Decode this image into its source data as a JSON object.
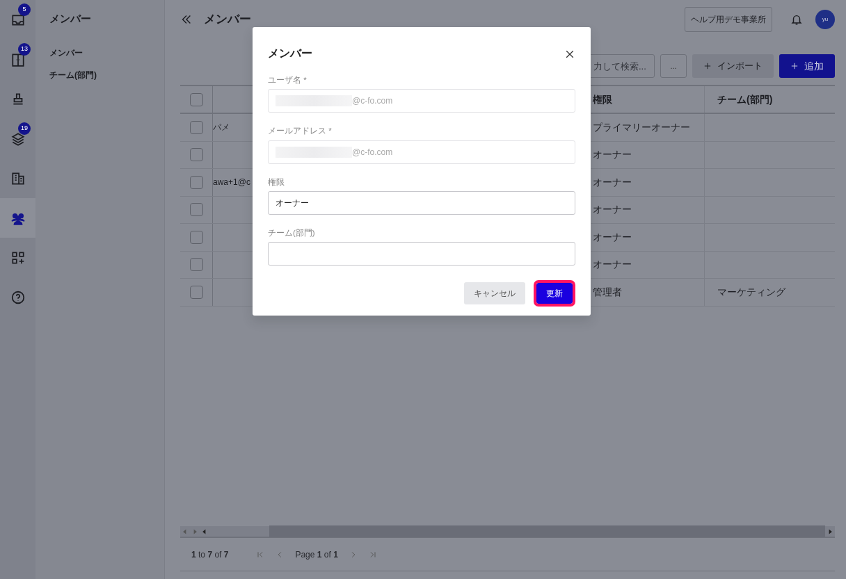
{
  "icon_rail": {
    "items": [
      {
        "badge": "5",
        "selected": false
      },
      {
        "badge": "13",
        "selected": false
      },
      {
        "selected": false
      },
      {
        "badge": "19",
        "selected": false
      },
      {
        "selected": false
      },
      {
        "selected": true
      },
      {
        "selected": false
      },
      {
        "selected": false
      }
    ]
  },
  "submenu": {
    "title": "メンバー",
    "items": [
      {
        "label": "メンバー",
        "selected": false
      },
      {
        "label": "チーム(部門)",
        "selected": false
      }
    ]
  },
  "header": {
    "title": "メンバー",
    "office_button": "ヘルプ用デモ事業所",
    "avatar": "yu"
  },
  "toolbar": {
    "search": {
      "placeholder": "力して検索..."
    },
    "more_button": "...",
    "import_button": "インポート",
    "add_button": "追加"
  },
  "table": {
    "select_all": {
      "checked": false
    },
    "columns": [
      "権限",
      "チーム(部門)"
    ],
    "rows": [
      {
        "checked": false,
        "column_2": "パメ",
        "role": "プライマリーオーナー"
      },
      {
        "checked": false,
        "role": "オーナー"
      },
      {
        "checked": false,
        "column_2": "awa+1@c",
        "role": "オーナー"
      },
      {
        "checked": false,
        "role": "オーナー"
      },
      {
        "checked": false,
        "role": "オーナー"
      },
      {
        "checked": false,
        "role": "オーナー"
      },
      {
        "checked": false,
        "role": "管理者",
        "team": "マーケティング"
      }
    ]
  },
  "pager": {
    "summary": "**1** to **7** of **7**",
    "page": "Page **1** of **1**"
  },
  "modal": {
    "title": "メンバー",
    "fields": [
      {
        "label": "ユーザ名 *",
        "value": "@c-fo.com",
        "disabled": true,
        "redacted": true
      },
      {
        "label": "メールアドレス *",
        "value": "@c-fo.com",
        "disabled": true,
        "redacted": true
      },
      {
        "label": "権限",
        "value": "オーナー",
        "disabled": false
      },
      {
        "label": "チーム(部門)",
        "disabled": false
      }
    ],
    "cancel_button": "キャンセル",
    "submit_button": {
      "label": "更新",
      "focused": true
    }
  }
}
